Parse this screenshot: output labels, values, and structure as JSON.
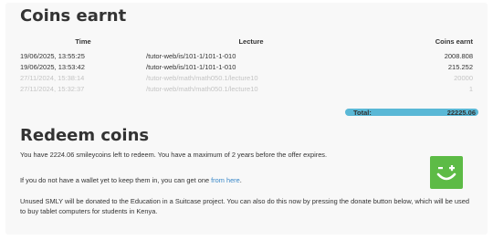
{
  "coins": {
    "title": "Coins earnt",
    "headers": {
      "time": "Time",
      "lecture": "Lecture",
      "coins": "Coins earnt"
    },
    "rows": [
      {
        "time": "19/06/2025, 13:55:25",
        "lecture": "/tutor-web/is/101-1/101-1-010",
        "coins": "2008.808",
        "faded": false
      },
      {
        "time": "19/06/2025, 13:53:42",
        "lecture": "/tutor-web/is/101-1/101-1-010",
        "coins": "215.252",
        "faded": false
      },
      {
        "time": "27/11/2024, 15:38:14",
        "lecture": "/tutor-web/math/math050.1/lecture10",
        "coins": "20000",
        "faded": true
      },
      {
        "time": "27/11/2024, 15:32:37",
        "lecture": "/tutor-web/math/math050.1/lecture10",
        "coins": "1",
        "faded": true
      }
    ],
    "total_label": "Total:",
    "total_value": "22225.06",
    "total_color": "#5ab8d6"
  },
  "redeem": {
    "title": "Redeem coins",
    "p1": "You have 2224.06 smileycoins left to redeem. You have a maximum of 2 years before the offer expires.",
    "p2_before": "If you do not have a wallet yet to keep them in, you can get one ",
    "p2_link": "from here",
    "p2_after": ".",
    "p3": "Unused SMLY will be donated to the Education in a Suitcase project. You can also do this now by pressing the donate button below, which will be used to buy tablet computers for students in Kenya.",
    "donate_icon": "smiley-plus-icon",
    "donate_color": "#5dbb46",
    "link_color": "#3a88c8"
  }
}
